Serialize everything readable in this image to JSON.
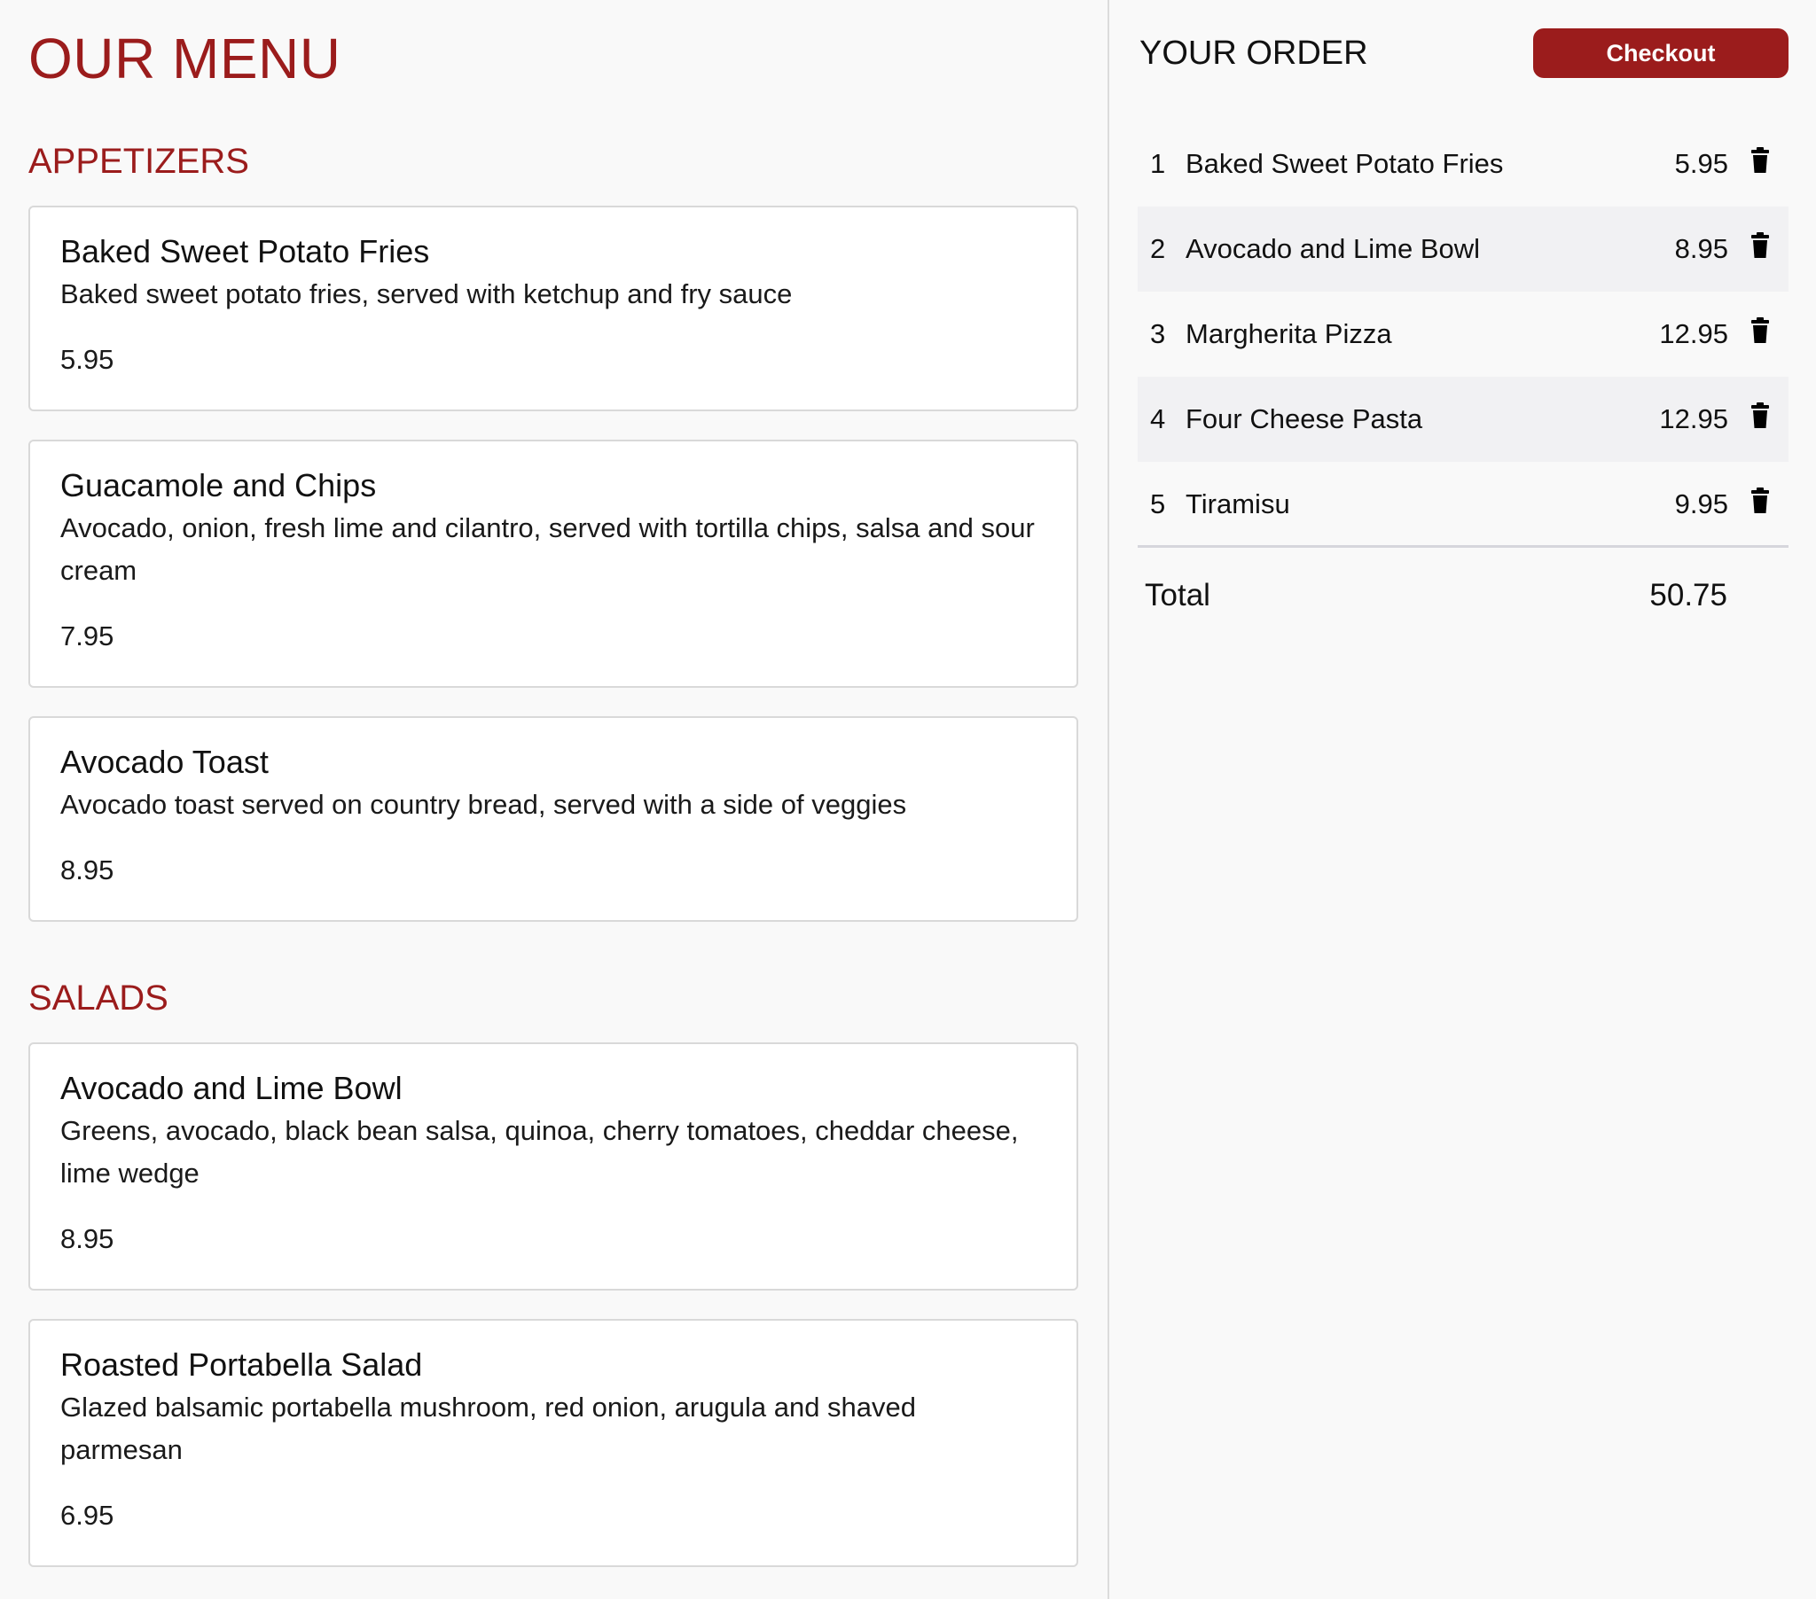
{
  "menu": {
    "title": "OUR MENU",
    "sections": [
      {
        "title": "APPETIZERS",
        "items": [
          {
            "name": "Baked Sweet Potato Fries",
            "description": "Baked sweet potato fries, served with ketchup and fry sauce",
            "price": "5.95"
          },
          {
            "name": "Guacamole and Chips",
            "description": "Avocado, onion, fresh lime and cilantro, served with tortilla chips, salsa and sour cream",
            "price": "7.95"
          },
          {
            "name": "Avocado Toast",
            "description": "Avocado toast served on country bread, served with a side of veggies",
            "price": "8.95"
          }
        ]
      },
      {
        "title": "SALADS",
        "items": [
          {
            "name": "Avocado and Lime Bowl",
            "description": "Greens, avocado, black bean salsa, quinoa, cherry tomatoes, cheddar cheese, lime wedge",
            "price": "8.95"
          },
          {
            "name": "Roasted Portabella Salad",
            "description": "Glazed balsamic portabella mushroom, red onion, arugula and shaved parmesan",
            "price": "6.95"
          }
        ]
      }
    ]
  },
  "order": {
    "title": "YOUR ORDER",
    "checkout_label": "Checkout",
    "items": [
      {
        "num": "1",
        "name": "Baked Sweet Potato Fries",
        "price": "5.95"
      },
      {
        "num": "2",
        "name": "Avocado and Lime Bowl",
        "price": "8.95"
      },
      {
        "num": "3",
        "name": "Margherita Pizza",
        "price": "12.95"
      },
      {
        "num": "4",
        "name": "Four Cheese Pasta",
        "price": "12.95"
      },
      {
        "num": "5",
        "name": "Tiramisu",
        "price": "9.95"
      }
    ],
    "remove_icon": "trash-icon",
    "total_label": "Total",
    "total_value": "50.75"
  },
  "colors": {
    "accent": "#9b1c1c",
    "background": "#f9f9f9",
    "card_background": "#ffffff",
    "card_border": "#d9d9d9",
    "row_alt": "#f1f1f3"
  }
}
